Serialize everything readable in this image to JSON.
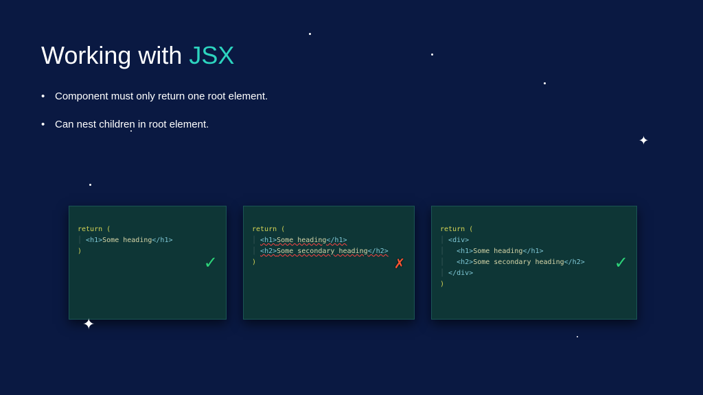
{
  "title": {
    "prefix": "Working with ",
    "highlight": "JSX"
  },
  "bullets": [
    "Component must only return one root element.",
    "Can nest children in root element."
  ],
  "code_examples": [
    {
      "status": "valid",
      "status_icon": "✓",
      "lines": {
        "return_kw": "return",
        "open_paren": " (",
        "indent": "| ",
        "h1_open": "<h1>",
        "h1_text": "Some heading",
        "h1_close": "</h1>",
        "close_paren": ")"
      }
    },
    {
      "status": "invalid",
      "status_icon": "✗",
      "lines": {
        "return_kw": "return",
        "open_paren": " (",
        "h1_open": "<h1>",
        "h1_text": "Some heading",
        "h1_close": "</h1>",
        "h2_open": "<h2>",
        "h2_text": "Some secondary heading",
        "h2_close": "</h2>",
        "close_paren": ")"
      }
    },
    {
      "status": "valid",
      "status_icon": "✓",
      "lines": {
        "return_kw": "return",
        "open_paren": " (",
        "div_open": "<div>",
        "h1_open": "<h1>",
        "h1_text": "Some heading",
        "h1_close": "</h1>",
        "h2_open": "<h2>",
        "h2_text": "Some secondary heading",
        "h2_close": "</h2>",
        "div_close": "</div>",
        "close_paren": ")"
      }
    }
  ]
}
